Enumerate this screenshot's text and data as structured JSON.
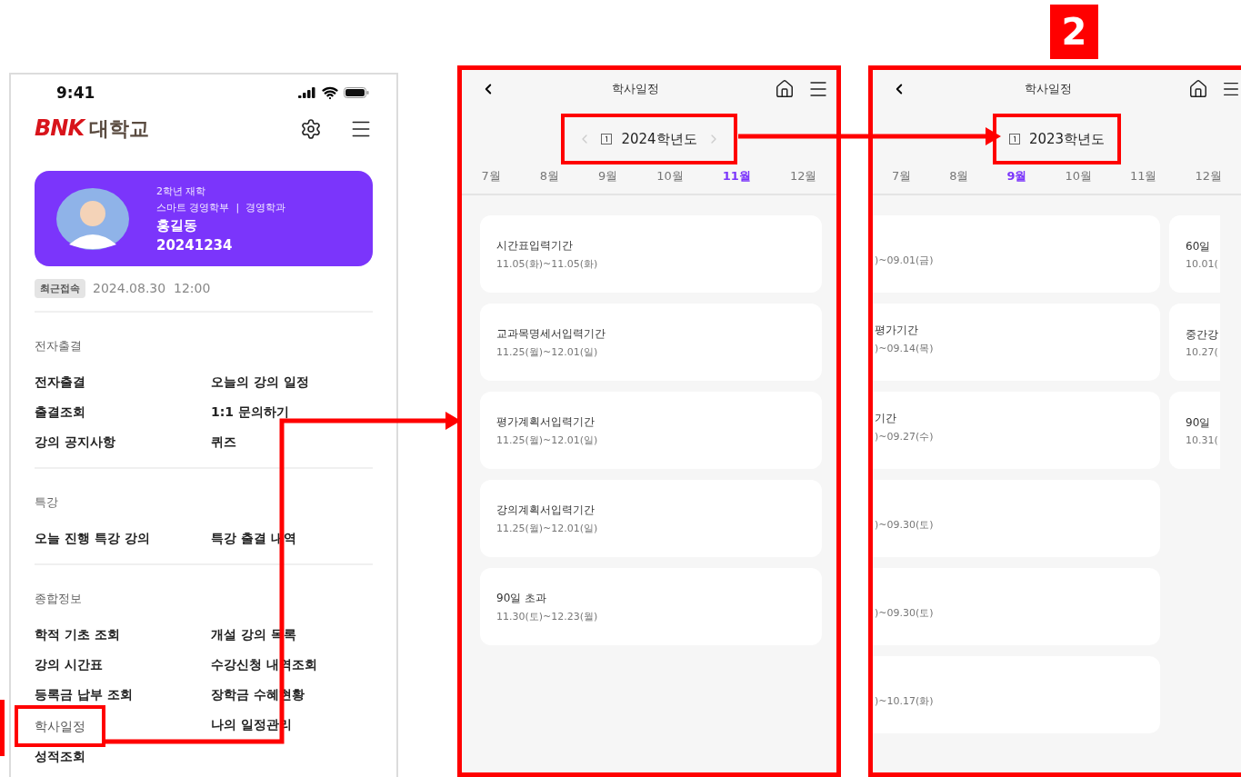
{
  "annotation_badge": "2",
  "home": {
    "status_bar": {
      "time": "9:41"
    },
    "logo": {
      "mark": "BNK",
      "name": "대학교"
    },
    "profile": {
      "year_status": "2학년 재학",
      "affiliation": "스마트 경영학부  |  경영학과",
      "name": "홍길동",
      "student_id": "20241234"
    },
    "last_login": {
      "label": "최근접속",
      "date": "2024.08.30  12:00"
    },
    "sections": [
      {
        "title": "전자출결",
        "items": [
          {
            "label": "전자출결",
            "annotated": false
          },
          {
            "label": "오늘의 강의 일정",
            "annotated": false
          },
          {
            "label": "출결조회",
            "annotated": false
          },
          {
            "label": "1:1 문의하기",
            "annotated": false
          },
          {
            "label": "강의 공지사항",
            "annotated": false
          },
          {
            "label": "퀴즈",
            "annotated": false
          }
        ]
      },
      {
        "title": "특강",
        "items": [
          {
            "label": "오늘 진행 특강 강의",
            "annotated": false
          },
          {
            "label": "특강 출결 내역",
            "annotated": false
          }
        ]
      },
      {
        "title": "종합정보",
        "items": [
          {
            "label": "학적 기초 조회",
            "annotated": false
          },
          {
            "label": "개설 강의 목록",
            "annotated": false
          },
          {
            "label": "강의 시간표",
            "annotated": false
          },
          {
            "label": "수강신청 내역조회",
            "annotated": false
          },
          {
            "label": "등록금 납부 조회",
            "annotated": false
          },
          {
            "label": "장학금 수혜현황",
            "annotated": false
          },
          {
            "label": "학사일정",
            "annotated": true
          },
          {
            "label": "나의 일정관리",
            "annotated": false
          },
          {
            "label": "성적조회",
            "annotated": false
          }
        ]
      }
    ]
  },
  "screens": [
    {
      "kind": "list",
      "title": "학사일정",
      "year": "2024학년도",
      "year_arrows": true,
      "year_annotated": true,
      "months": [
        {
          "label": "7월",
          "selected": false
        },
        {
          "label": "8월",
          "selected": false
        },
        {
          "label": "9월",
          "selected": false
        },
        {
          "label": "10월",
          "selected": false
        },
        {
          "label": "11월",
          "selected": true
        },
        {
          "label": "12월",
          "selected": false
        }
      ],
      "events": [
        {
          "title": "시간표입력기간",
          "dates": "11.05(화)~11.05(화)"
        },
        {
          "title": "교과목명세서입력기간",
          "dates": "11.25(월)~12.01(일)"
        },
        {
          "title": "평가계획서입력기간",
          "dates": "11.25(월)~12.01(일)"
        },
        {
          "title": "강의계획서입력기간",
          "dates": "11.25(월)~12.01(일)"
        },
        {
          "title": "90일 초과",
          "dates": "11.30(토)~12.23(월)"
        }
      ]
    },
    {
      "kind": "scrolled",
      "title": "학사일정",
      "year": "2023학년도",
      "year_arrows": false,
      "year_annotated": true,
      "months": [
        {
          "label": "7월",
          "selected": false
        },
        {
          "label": "8월",
          "selected": false
        },
        {
          "label": "9월",
          "selected": true
        },
        {
          "label": "10월",
          "selected": false
        },
        {
          "label": "11월",
          "selected": false
        },
        {
          "label": "12월",
          "selected": false
        }
      ],
      "events": [
        {
          "dates": ")~09.01(금)"
        },
        {
          "title": "평가기간",
          "dates": ")~09.14(목)"
        },
        {
          "title": "기간",
          "dates": ")~09.27(수)"
        },
        {
          "dates": ")~09.30(토)"
        },
        {
          "dates": ")~09.30(토)"
        },
        {
          "dates": ")~10.17(화)"
        }
      ],
      "side_events": [
        {
          "title": "60일",
          "dates": "10.01("
        },
        {
          "title": "중간강",
          "dates": "10.27("
        },
        {
          "title": "90일",
          "dates": "10.31("
        }
      ]
    }
  ]
}
